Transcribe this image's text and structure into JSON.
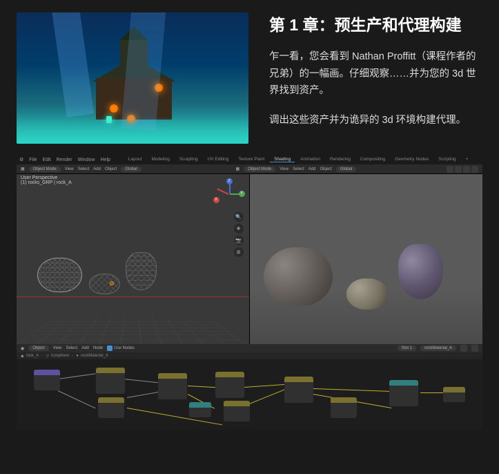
{
  "chapter": {
    "title": "第 1 章：预生产和代理构建",
    "para1": "乍一看，您会看到 Nathan Proffitt（课程作者的兄弟）的一幅画。仔细观察……并为您的 3d 世界找到资产。",
    "para2": "调出这些资产并为诡异的 3d 环境构建代理。"
  },
  "blender": {
    "menubar": [
      "File",
      "Edit",
      "Render",
      "Window",
      "Help"
    ],
    "workspace_tabs": [
      "Layout",
      "Modeling",
      "Sculpting",
      "UV Editing",
      "Texture Paint",
      "Shading",
      "Animation",
      "Rendering",
      "Compositing",
      "Geometry Nodes",
      "Scripting"
    ],
    "active_tab": "Shading",
    "toolbar_left": {
      "mode": "Object Mode",
      "menus": [
        "View",
        "Select",
        "Add",
        "Object"
      ],
      "orientation": "Global"
    },
    "toolbar_right": {
      "mode": "Object Mode",
      "menus": [
        "View",
        "Select",
        "Add",
        "Object"
      ],
      "orientation": "Global"
    },
    "viewport_left": {
      "perspective_label": "User Perspective",
      "collection_path": "(1) rocks_GRP | rock_A"
    },
    "node_editor": {
      "menus": [
        "View",
        "Select",
        "Add",
        "Node"
      ],
      "object_dropdown": "Object",
      "use_nodes_label": "Use Nodes",
      "slot_label": "Slot 1",
      "material_name": "rockMaterial_A",
      "breadcrumb": [
        "rock_A",
        "Icosphere",
        "rockMaterial_A"
      ]
    }
  }
}
